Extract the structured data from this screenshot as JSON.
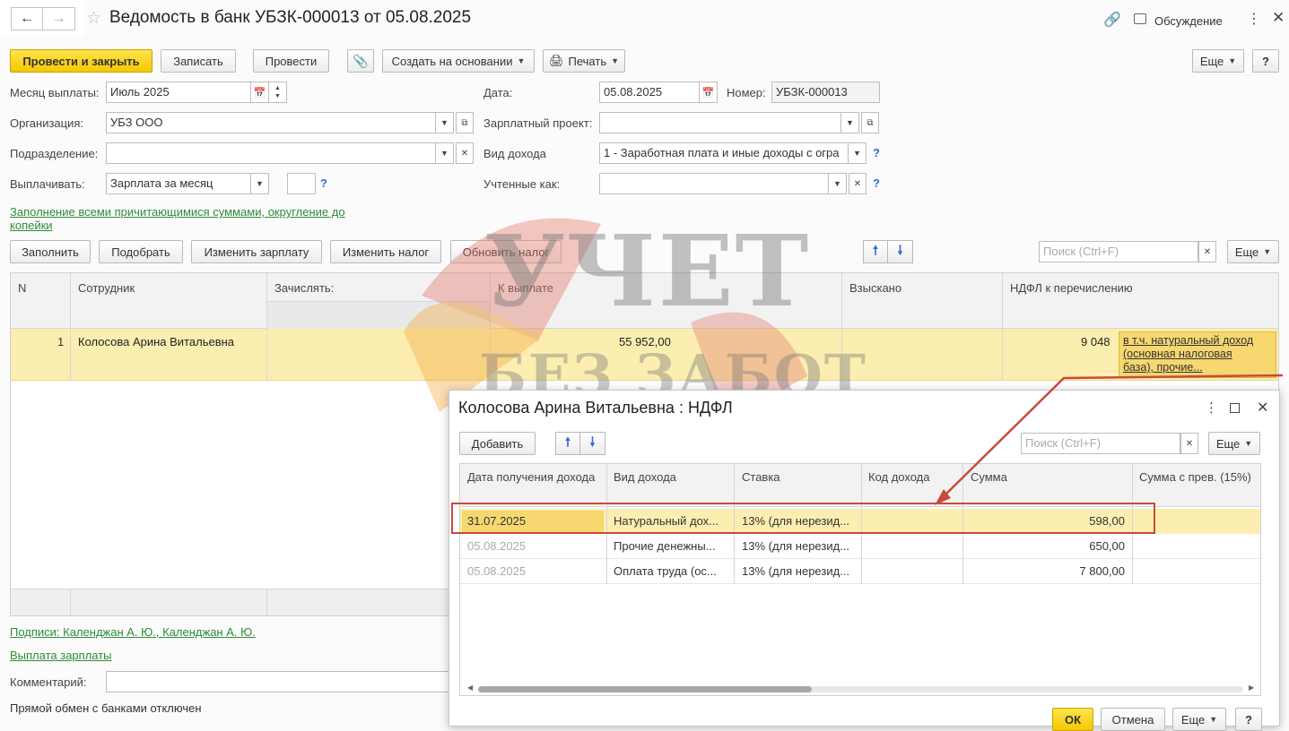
{
  "window": {
    "title": "Ведомость в банк УБЗК-000013 от 05.08.2025",
    "discussion_label": "Обсуждение"
  },
  "toolbar": {
    "post_close": "Провести и закрыть",
    "save": "Записать",
    "post": "Провести",
    "create_based": "Создать на основании",
    "print": "Печать",
    "more": "Еще",
    "help": "?"
  },
  "form": {
    "pay_month_label": "Месяц выплаты:",
    "pay_month_value": "Июль 2025",
    "date_label": "Дата:",
    "date_value": "05.08.2025",
    "number_label": "Номер:",
    "number_value": "УБЗК-000013",
    "org_label": "Организация:",
    "org_value": "УБЗ ООО",
    "salary_project_label": "Зарплатный проект:",
    "salary_project_value": "",
    "division_label": "Подразделение:",
    "division_value": "",
    "income_type_label": "Вид дохода",
    "income_type_value": "1 - Заработная плата и иные доходы с огра",
    "pay_label": "Выплачивать:",
    "pay_value": "Зарплата за месяц",
    "counted_as_label": "Учтенные как:",
    "counted_as_value": "",
    "fill_link_line1": "Заполнение всеми причитающимися суммами, округление до",
    "fill_link_line2": "копейки"
  },
  "table_toolbar": {
    "fill": "Заполнить",
    "select": "Подобрать",
    "change_salary": "Изменить зарплату",
    "change_tax": "Изменить налог",
    "update_tax": "Обновить налог",
    "search_placeholder": "Поиск (Ctrl+F)",
    "more": "Еще"
  },
  "table": {
    "columns": [
      "N",
      "Сотрудник",
      "Зачислять:",
      "К выплате",
      "Взыскано",
      "НДФЛ к перечислению"
    ],
    "rows": [
      {
        "n": "1",
        "employee": "Колосова Арина Витальевна",
        "credit": "",
        "to_pay": "55 952,00",
        "collected": "",
        "ndfl": "9 048",
        "ndfl_note_line1": "в т.ч. натуральный доход",
        "ndfl_note_line2": "(основная налоговая",
        "ndfl_note_line3": "база), прочие..."
      }
    ]
  },
  "footer": {
    "signatures_link": "Подписи: Календжан А. Ю., Календжан А. Ю.",
    "payroll_link": "Выплата зарплаты",
    "comment_label": "Комментарий:",
    "comment_value": "",
    "exchange_status": "Прямой обмен с банками отключен"
  },
  "dialog": {
    "title": "Колосова Арина Витальевна : НДФЛ",
    "add": "Добавить",
    "search_placeholder": "Поиск (Ctrl+F)",
    "more": "Еще",
    "columns": [
      "Дата получения дохода",
      "Вид дохода",
      "Ставка",
      "Код дохода",
      "Сумма",
      "Сумма с прев. (15%)"
    ],
    "rows": [
      {
        "date": "31.07.2025",
        "type": "Натуральный дох...",
        "rate": "13% (для нерезид...",
        "code": "",
        "sum": "598,00",
        "sum15": ""
      },
      {
        "date": "05.08.2025",
        "type": "Прочие денежны...",
        "rate": "13% (для нерезид...",
        "code": "",
        "sum": "650,00",
        "sum15": ""
      },
      {
        "date": "05.08.2025",
        "type": "Оплата труда (ос...",
        "rate": "13% (для нерезид...",
        "code": "",
        "sum": "7 800,00",
        "sum15": ""
      }
    ],
    "ok": "ОК",
    "cancel": "Отмена",
    "help": "?"
  },
  "watermark": {
    "line1": "УЧЕТ",
    "line2": "БЕЗ ЗАБОТ"
  },
  "colors": {
    "primary_button": "#f5c800",
    "selected_row": "#fbeeb0",
    "link": "#2e8b3a",
    "highlight_frame": "#c94a3a"
  }
}
